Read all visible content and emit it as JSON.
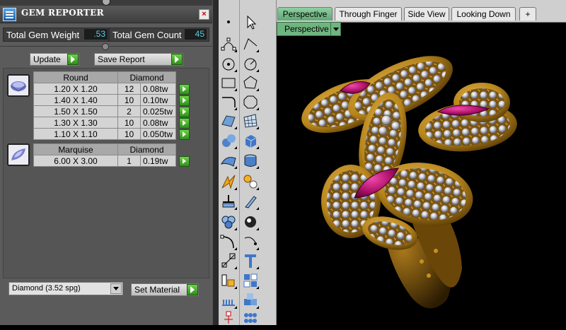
{
  "panel": {
    "title": "GEM REPORTER",
    "close_glyph": "×",
    "total_weight_label": "Total Gem Weight",
    "total_weight_value": ".53",
    "total_count_label": "Total Gem Count",
    "total_count_value": "45",
    "update_label": "Update",
    "save_report_label": "Save Report",
    "groups": [
      {
        "shape": "Round",
        "material": "Diamond",
        "icon": "round-gem-icon",
        "rows": [
          {
            "size": "1.20 X 1.20",
            "count": "12",
            "weight": "0.08tw"
          },
          {
            "size": "1.40 X 1.40",
            "count": "10",
            "weight": "0.10tw"
          },
          {
            "size": "1.50 X 1.50",
            "count": "2",
            "weight": "0.025tw"
          },
          {
            "size": "1.30 X 1.30",
            "count": "10",
            "weight": "0.08tw"
          },
          {
            "size": "1.10 X 1.10",
            "count": "10",
            "weight": "0.050tw"
          }
        ]
      },
      {
        "shape": "Marquise",
        "material": "Diamond",
        "icon": "marquise-gem-icon",
        "rows": [
          {
            "size": "6.00 X 3.00",
            "count": "1",
            "weight": "0.19tw"
          }
        ]
      }
    ],
    "material_select_value": "Diamond    (3.52 spg)",
    "set_material_label": "Set Material"
  },
  "viewport": {
    "tabs": [
      "Perspective",
      "Through Finger",
      "Side View",
      "Looking Down"
    ],
    "active_tab": "Perspective",
    "add_tab_glyph": "+",
    "view_mode": "Perspective"
  },
  "colors": {
    "metal": "#b8861c",
    "ruby": "#c0147a",
    "tab_active": "#6fb57f",
    "go_button": "#3aa324",
    "value_text": "#4fd1e6"
  },
  "toolbar_icons": [
    "point-icon",
    "select-arrow-icon",
    "control-points-icon",
    "polyline-icon",
    "circle-point-icon",
    "circle-icon",
    "rectangle-icon",
    "polygon-icon",
    "curve-icon",
    "octagon-icon",
    "surface-icon",
    "mesh-surface-icon",
    "sphere-icon",
    "box-icon",
    "deform-surface-icon",
    "cylinder-icon",
    "lightning-icon",
    "gear-icon",
    "join-icon",
    "knife-icon",
    "boolean-icon",
    "shell-icon",
    "fillet-icon",
    "rotate-icon",
    "scale-icon",
    "text-icon",
    "array-icon",
    "grid-icon",
    "ruler-icon",
    "cubes-icon",
    "pave-icon",
    "tile-icon",
    "tree-icon",
    "gems-icon"
  ]
}
